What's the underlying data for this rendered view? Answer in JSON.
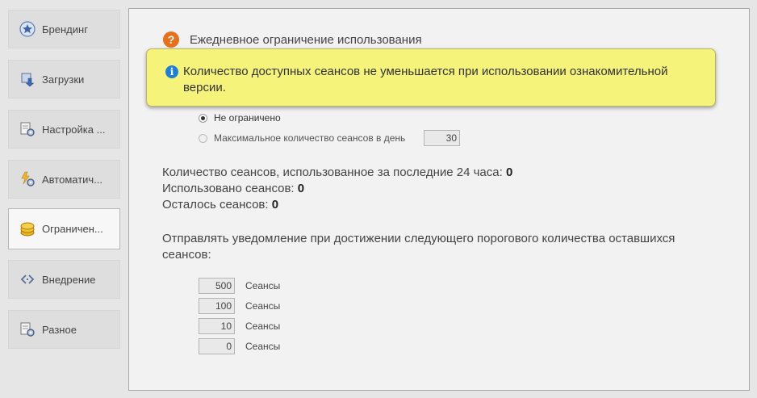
{
  "sidebar": {
    "items": [
      {
        "label": "Брендинг",
        "icon": "star-badge-icon"
      },
      {
        "label": "Загрузки",
        "icon": "download-icon"
      },
      {
        "label": "Настройка ...",
        "icon": "settings-page-icon"
      },
      {
        "label": "Автоматич...",
        "icon": "automation-gear-icon"
      },
      {
        "label": "Ограничен...",
        "icon": "coins-icon",
        "active": true
      },
      {
        "label": "Внедрение",
        "icon": "code-brackets-icon"
      },
      {
        "label": "Разное",
        "icon": "misc-settings-icon"
      }
    ]
  },
  "section": {
    "title": "Ежедневное ограничение использования"
  },
  "tooltip": {
    "text": "Количество доступных сеансов не уменьшается при использовании ознакомительной версии."
  },
  "limit": {
    "unlimited_label": "Не ограничено",
    "max_label": "Максимальное количество сеансов в день",
    "max_value": "30",
    "selected": "unlimited"
  },
  "stats": {
    "used_24h_label": "Количество сеансов, использованное за последние 24 часа: ",
    "used_24h_value": "0",
    "used_label": "Использовано сеансов: ",
    "used_value": "0",
    "remaining_label": "Осталось сеансов: ",
    "remaining_value": "0"
  },
  "notify": {
    "text": "Отправлять уведомление при достижении следующего порогового количества оставшихся сеансов:"
  },
  "thresholds": [
    {
      "value": "500",
      "unit": "Сеансы"
    },
    {
      "value": "100",
      "unit": "Сеансы"
    },
    {
      "value": "10",
      "unit": "Сеансы"
    },
    {
      "value": "0",
      "unit": "Сеансы"
    }
  ]
}
